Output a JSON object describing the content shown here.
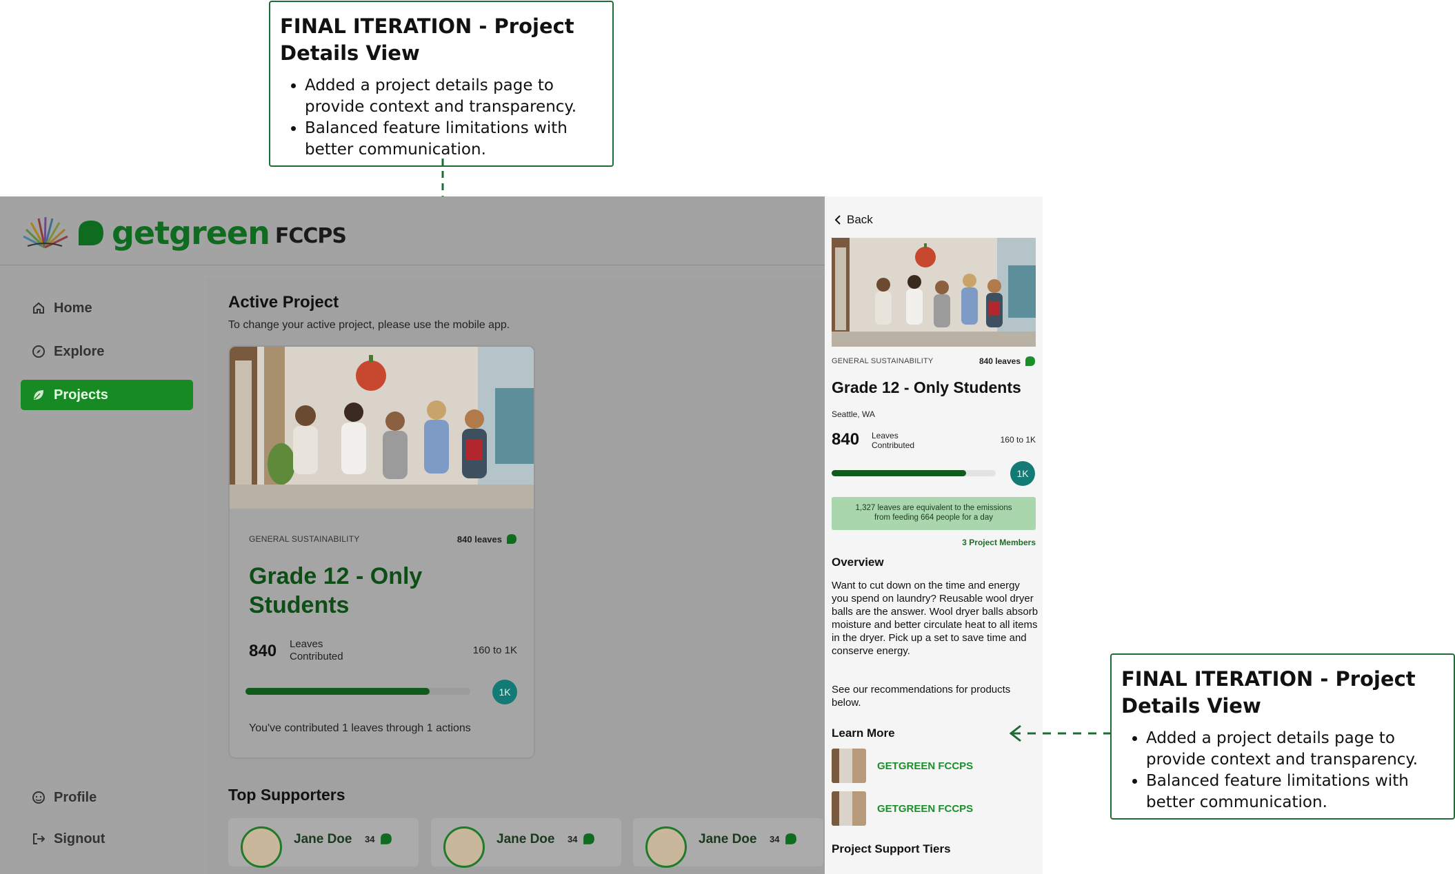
{
  "annotation_top": {
    "title": "FINAL ITERATION - Project Details View",
    "bullets": [
      "Added a project details page to provide context and transparency.",
      "Balanced feature limitations with better communication."
    ]
  },
  "annotation_right": {
    "title": "FINAL ITERATION - Project Details View",
    "bullets": [
      "Added a project details page to provide context and transparency.",
      "Balanced feature limitations with better communication."
    ]
  },
  "brand": {
    "name": "getgreen",
    "sub": "FCCPS"
  },
  "sidebar": {
    "items": [
      {
        "label": "Home",
        "icon": "home-icon"
      },
      {
        "label": "Explore",
        "icon": "compass-icon"
      },
      {
        "label": "Projects",
        "icon": "leaf-icon",
        "active": true
      }
    ],
    "bottom": [
      {
        "label": "Profile",
        "icon": "face-icon"
      },
      {
        "label": "Signout",
        "icon": "signout-icon"
      }
    ]
  },
  "main": {
    "title": "Active Project",
    "subtitle": "To change your active project, please use the mobile app.",
    "card": {
      "tag": "GENERAL SUSTAINABILITY",
      "leaves": "840 leaves",
      "title_line1": "Grade 12 - Only",
      "title_line2": "Students",
      "count": "840",
      "count_label_1": "Leaves",
      "count_label_2": "Contributed",
      "range": "160 to 1K",
      "progress": 0.82,
      "goal": "1K",
      "contributed_text": "You've contributed 1 leaves through 1 actions"
    },
    "supporters_title": "Top Supporters",
    "supporters": [
      {
        "name": "Jane Doe",
        "count": "34"
      },
      {
        "name": "Jane Doe",
        "count": "34"
      },
      {
        "name": "Jane Doe",
        "count": "34"
      }
    ]
  },
  "mobile": {
    "back": "Back",
    "tag": "GENERAL SUSTAINABILITY",
    "leaves": "840 leaves",
    "title": "Grade 12 - Only Students",
    "location": "Seattle, WA",
    "count": "840",
    "count_label_1": "Leaves",
    "count_label_2": "Contributed",
    "range": "160 to 1K",
    "progress": 0.82,
    "goal": "1K",
    "equivalent_line1": "1,327 leaves are equivalent to the emissions",
    "equivalent_line2": "from feeding 664 people for a day",
    "members": "3 Project Members",
    "overview_title": "Overview",
    "overview_text": "Want to cut down on the time and energy you spend on laundry? Reusable wool dryer balls are the answer. Wool dryer balls absorb moisture and better circulate heat to all items in the dryer. Pick up a set to save time and conserve energy.",
    "overview_text2": "See our recommendations for products below.",
    "learn_title": "Learn More",
    "links": [
      "GETGREEN FCCPS",
      "GETGREEN FCCPS"
    ],
    "tiers_title": "Project Support Tiers"
  },
  "colors": {
    "brand_green": "#0e6b1f",
    "active_nav": "#178a23",
    "progress_fill": "#0f5a1c",
    "goal_badge": "#137a76",
    "callout_border": "#1f6b35"
  }
}
